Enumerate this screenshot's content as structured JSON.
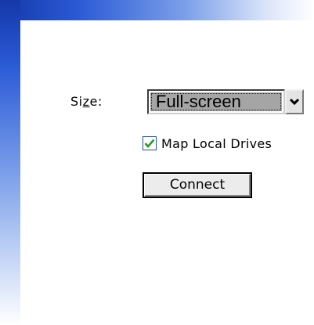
{
  "form": {
    "size_label_prefix": "Si",
    "size_label_accel": "z",
    "size_label_suffix": "e:",
    "size_selected": "Full-screen",
    "map_drives_label": "Map Local Drives",
    "map_drives_checked": true,
    "connect_label": "Connect"
  },
  "icons": {
    "dropdown": "chevron-down-icon",
    "check": "checkmark-icon"
  },
  "colors": {
    "frame_blue": "#1438a8",
    "checkmark_green": "#2a9a2a",
    "selection_gray": "#a5a5a5"
  }
}
